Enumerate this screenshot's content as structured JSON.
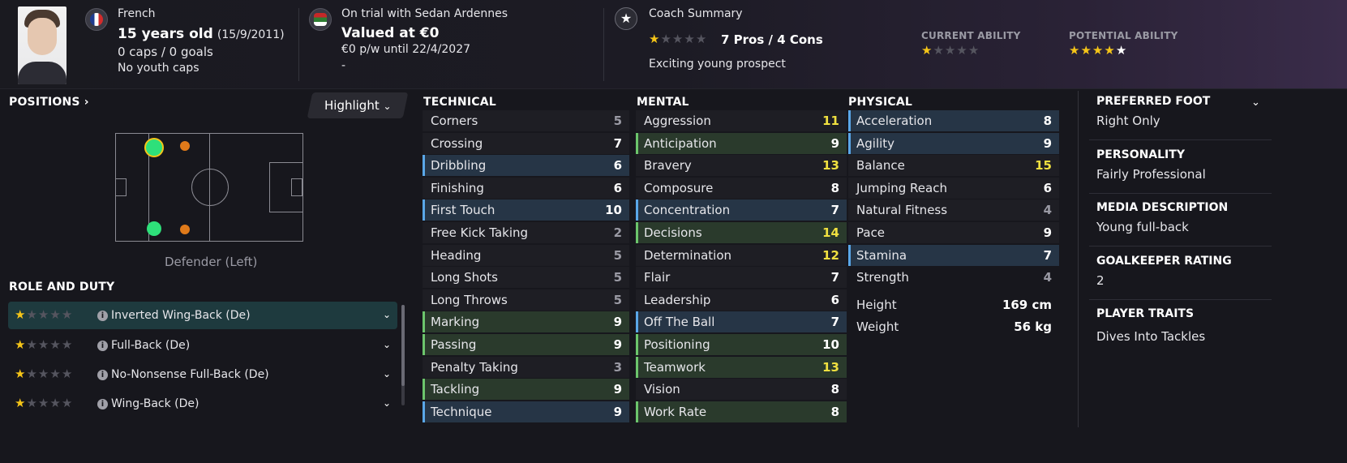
{
  "header": {
    "nationality": "French",
    "age": "15 years old",
    "dob": "(15/9/2011)",
    "caps": "0 caps / 0 goals",
    "youth_caps": "No youth caps",
    "club_status": "On trial with Sedan Ardennes",
    "value": "Valued at €0",
    "wage": "€0 p/w until 22/4/2027",
    "dash": "-",
    "coach_summary_title": "Coach Summary",
    "coach_summary_stars": 1,
    "pros_cons": "7 Pros / 4 Cons",
    "coach_comment": "Exciting young prospect",
    "current_ability_label": "CURRENT ABILITY",
    "current_ability_stars": 1,
    "potential_ability_label": "POTENTIAL ABILITY",
    "potential_ability_stars": 4
  },
  "positions": {
    "title": "POSITIONS",
    "highlight_label": "Highlight",
    "position_caption": "Defender (Left)"
  },
  "roles": {
    "title": "ROLE AND DUTY",
    "items": [
      {
        "name": "Inverted Wing-Back (De)",
        "stars": 1,
        "selected": true
      },
      {
        "name": "Full-Back (De)",
        "stars": 1
      },
      {
        "name": "No-Nonsense Full-Back (De)",
        "stars": 1
      },
      {
        "name": "Wing-Back (De)",
        "stars": 1
      }
    ]
  },
  "technical": {
    "title": "TECHNICAL",
    "attrs": [
      {
        "name": "Corners",
        "value": "5"
      },
      {
        "name": "Crossing",
        "value": "7"
      },
      {
        "name": "Dribbling",
        "value": "6"
      },
      {
        "name": "Finishing",
        "value": "6"
      },
      {
        "name": "First Touch",
        "value": "10"
      },
      {
        "name": "Free Kick Taking",
        "value": "2"
      },
      {
        "name": "Heading",
        "value": "5"
      },
      {
        "name": "Long Shots",
        "value": "5"
      },
      {
        "name": "Long Throws",
        "value": "5"
      },
      {
        "name": "Marking",
        "value": "9"
      },
      {
        "name": "Passing",
        "value": "9"
      },
      {
        "name": "Penalty Taking",
        "value": "3"
      },
      {
        "name": "Tackling",
        "value": "9"
      },
      {
        "name": "Technique",
        "value": "9"
      }
    ]
  },
  "mental": {
    "title": "MENTAL",
    "attrs": [
      {
        "name": "Aggression",
        "value": "11"
      },
      {
        "name": "Anticipation",
        "value": "9"
      },
      {
        "name": "Bravery",
        "value": "13"
      },
      {
        "name": "Composure",
        "value": "8"
      },
      {
        "name": "Concentration",
        "value": "7"
      },
      {
        "name": "Decisions",
        "value": "14"
      },
      {
        "name": "Determination",
        "value": "12"
      },
      {
        "name": "Flair",
        "value": "7"
      },
      {
        "name": "Leadership",
        "value": "6"
      },
      {
        "name": "Off The Ball",
        "value": "7"
      },
      {
        "name": "Positioning",
        "value": "10"
      },
      {
        "name": "Teamwork",
        "value": "13"
      },
      {
        "name": "Vision",
        "value": "8"
      },
      {
        "name": "Work Rate",
        "value": "8"
      }
    ]
  },
  "physical": {
    "title": "PHYSICAL",
    "attrs": [
      {
        "name": "Acceleration",
        "value": "8"
      },
      {
        "name": "Agility",
        "value": "9"
      },
      {
        "name": "Balance",
        "value": "15"
      },
      {
        "name": "Jumping Reach",
        "value": "6"
      },
      {
        "name": "Natural Fitness",
        "value": "4"
      },
      {
        "name": "Pace",
        "value": "9"
      },
      {
        "name": "Stamina",
        "value": "7"
      },
      {
        "name": "Strength",
        "value": "4"
      }
    ],
    "height_label": "Height",
    "height_value": "169 cm",
    "weight_label": "Weight",
    "weight_value": "56 kg"
  },
  "info": {
    "preferred_foot_label": "PREFERRED FOOT",
    "preferred_foot_value": "Right Only",
    "personality_label": "PERSONALITY",
    "personality_value": "Fairly Professional",
    "media_label": "MEDIA DESCRIPTION",
    "media_value": "Young full-back",
    "gk_label": "GOALKEEPER RATING",
    "gk_value": "2",
    "traits_label": "PLAYER TRAITS",
    "traits_value": "Dives Into Tackles"
  },
  "colors": {
    "accent_star": "#f5c518",
    "green_highlight": "#6cc56c",
    "blue_highlight": "#5aa7e8",
    "high_value": "#f0e040"
  }
}
